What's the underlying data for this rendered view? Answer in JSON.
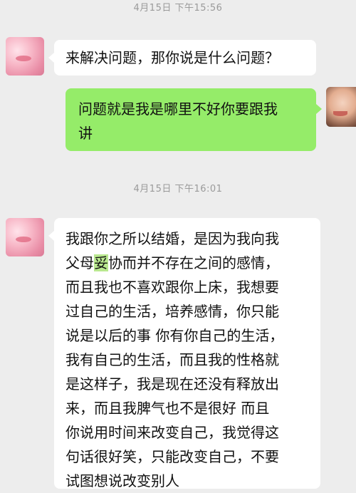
{
  "timestamps": [
    "4月15日 下午15:56",
    "4月15日 下午16:01"
  ],
  "messages": [
    {
      "side": "left",
      "text": "来解决问题，那你说是什么问题？"
    },
    {
      "side": "right",
      "lines": [
        "问题就是我是哪里不好你要跟我",
        "讲"
      ]
    },
    {
      "side": "left",
      "lines": [
        "我跟你之所以结婚，是因为我向我",
        "父母",
        "妥",
        "协而并不存在之间的感情，",
        "而且我也不喜欢跟你上床，我想要",
        "过自己的生活，培养感情，你只能",
        "说是以后的事 你有你自己的生活，",
        "我有自己的生活，而且我的性格就",
        "是这样子，我是现在还没有释放出",
        "来，而且我脾气也不是很好 而且",
        "你说用时间来改变自己，我觉得这",
        "句话很好笑，只能改变自己，不要",
        "试图想说改变别人"
      ]
    }
  ]
}
